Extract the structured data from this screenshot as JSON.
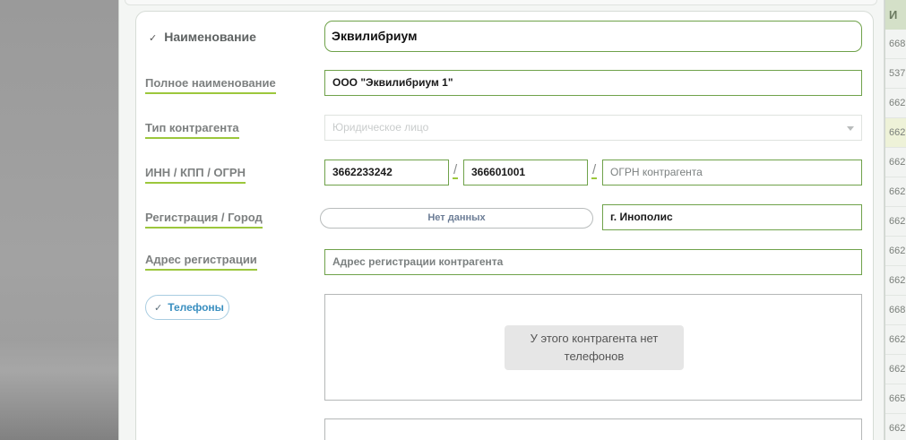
{
  "form": {
    "name_label": "Наименование",
    "name_value": "Эквилибриум",
    "full_name_label": "Полное наименование",
    "full_name_value": "ООО \"Эквилибриум 1\"",
    "type_label": "Тип контрагента",
    "type_value": "Юридическое лицо",
    "ids_label": "ИНН / КПП / ОГРН",
    "inn_value": "3662233242",
    "kpp_value": "366601001",
    "ogrn_placeholder": "ОГРН контрагента",
    "separator": "/",
    "registration_label": "Регистрация / Город",
    "registration_button": "Нет данных",
    "city_value": "г. Инополис",
    "address_label": "Адрес регистрации",
    "address_placeholder": "Адрес регистрации контрагента",
    "phones_chip": "Телефоны",
    "phones_empty": "У этого контрагента нет телефонов"
  },
  "side_table": {
    "header": "И",
    "rows": [
      "668",
      "537",
      "662",
      "662",
      "662",
      "662",
      "662",
      "662",
      "662",
      "662",
      "668",
      "662",
      "662",
      "665",
      "662"
    ]
  },
  "icons": {
    "check": "✓"
  },
  "colors": {
    "accent_underline": "#9cc73c",
    "field_border": "#6fa24a",
    "chip_text": "#3a8fc0"
  }
}
